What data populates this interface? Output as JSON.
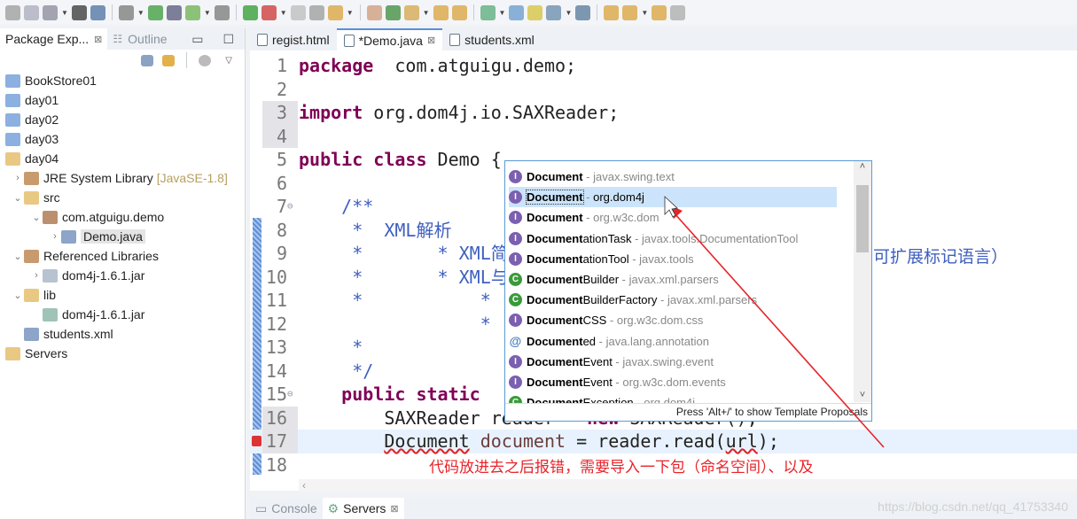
{
  "toolbar": {
    "icons": [
      "new",
      "save",
      "save-all",
      "user",
      "console",
      "debug-skip",
      "spring",
      "layout",
      "spring-boot",
      "debug",
      "run",
      "run-config",
      "stop",
      "external-tools",
      "new-package",
      "new-class",
      "refresh",
      "open-folder",
      "folder",
      "search",
      "open-type",
      "task",
      "marker",
      "pin",
      "globe",
      "next-annotation",
      "prev-annotation",
      "back",
      "forward"
    ]
  },
  "left": {
    "tabs": [
      {
        "label": "Package Exp...",
        "close": "⊠"
      },
      {
        "label": "Outline"
      }
    ],
    "tree": [
      {
        "label": "BookStore01",
        "depth": 0,
        "twisty": "",
        "icon": "web-project"
      },
      {
        "label": "day01",
        "depth": 0,
        "twisty": "",
        "icon": "web-project-warning"
      },
      {
        "label": "day02",
        "depth": 0,
        "twisty": "",
        "icon": "web-project"
      },
      {
        "label": "day03",
        "depth": 0,
        "twisty": "",
        "icon": "web-project"
      },
      {
        "label": "day04",
        "depth": 0,
        "twisty": "",
        "icon": "java-project"
      },
      {
        "label": "JRE System Library",
        "suffix": "[JavaSE-1.8]",
        "depth": 1,
        "twisty": "›",
        "icon": "library"
      },
      {
        "label": "src",
        "depth": 1,
        "twisty": "⌄",
        "icon": "source-folder"
      },
      {
        "label": "com.atguigu.demo",
        "depth": 2,
        "twisty": "⌄",
        "icon": "package"
      },
      {
        "label": "Demo.java",
        "depth": 3,
        "twisty": "›",
        "icon": "java-file",
        "selected": true
      },
      {
        "label": "Referenced Libraries",
        "depth": 1,
        "twisty": "⌄",
        "icon": "library"
      },
      {
        "label": "dom4j-1.6.1.jar",
        "depth": 2,
        "twisty": "›",
        "icon": "jar"
      },
      {
        "label": "lib",
        "depth": 1,
        "twisty": "⌄",
        "icon": "folder"
      },
      {
        "label": "dom4j-1.6.1.jar",
        "depth": 2,
        "twisty": "",
        "icon": "jar-file"
      },
      {
        "label": "students.xml",
        "depth": 1,
        "twisty": "",
        "icon": "xml-file"
      },
      {
        "label": "Servers",
        "depth": 0,
        "twisty": "",
        "icon": "folder"
      }
    ]
  },
  "editor": {
    "tabs": [
      {
        "label": "regist.html"
      },
      {
        "label": "*Demo.java",
        "close": "⊠",
        "active": true
      },
      {
        "label": "students.xml"
      }
    ],
    "lines": [
      {
        "n": "1",
        "seg": [
          [
            "kw",
            "package"
          ],
          [
            "",
            "  com.atguigu.demo;"
          ]
        ]
      },
      {
        "n": "2",
        "seg": []
      },
      {
        "n": "3",
        "seg": [
          [
            "kw",
            "import"
          ],
          [
            "",
            " org.dom4j.io.SAXReader;"
          ]
        ]
      },
      {
        "n": "4",
        "seg": []
      },
      {
        "n": "5",
        "seg": [
          [
            "kw",
            "public"
          ],
          [
            "",
            " "
          ],
          [
            "kw",
            "class"
          ],
          [
            "",
            " Demo {"
          ]
        ]
      },
      {
        "n": "6",
        "seg": []
      },
      {
        "n": "7",
        "seg": [
          [
            "cm",
            "    /**"
          ]
        ]
      },
      {
        "n": "8",
        "seg": [
          [
            "cm",
            "     *  XML解析"
          ]
        ]
      },
      {
        "n": "9",
        "seg": [
          [
            "cm",
            "     *       * XML简"
          ]
        ]
      },
      {
        "n": "10",
        "seg": [
          [
            "cm",
            "     *       * XML与"
          ]
        ]
      },
      {
        "n": "11",
        "seg": [
          [
            "cm",
            "     *           *"
          ]
        ]
      },
      {
        "n": "12",
        "seg": [
          [
            "cm",
            "                 *"
          ]
        ]
      },
      {
        "n": "13",
        "seg": [
          [
            "cm",
            "     *"
          ]
        ]
      },
      {
        "n": "14",
        "seg": [
          [
            "cm",
            "     */"
          ]
        ]
      },
      {
        "n": "15",
        "seg": [
          [
            "",
            "    "
          ],
          [
            "kw",
            "public"
          ],
          [
            "",
            " "
          ],
          [
            "kw",
            "static"
          ]
        ]
      },
      {
        "n": "16",
        "seg": [
          [
            "",
            "        SAXReader reader = "
          ],
          [
            "kw",
            "new"
          ],
          [
            "",
            " SAXReader();"
          ]
        ]
      },
      {
        "n": "17",
        "seg": [
          [
            "",
            "        "
          ],
          [
            "err",
            "Document"
          ],
          [
            "",
            " "
          ],
          [
            "var",
            "document"
          ],
          [
            "",
            " = reader.read("
          ],
          [
            "err",
            "url"
          ],
          [
            "",
            ");"
          ]
        ],
        "current": true
      },
      {
        "n": "18",
        "seg": []
      }
    ],
    "line9_tail": "可扩展标记语言）",
    "hscroll": "‹"
  },
  "popup": {
    "items": [
      {
        "bold": "Document",
        "rest": "",
        "pkg": "javax.swing.text",
        "icon": "interface"
      },
      {
        "bold": "Document",
        "rest": "",
        "pkg": "org.dom4j",
        "icon": "interface",
        "selected": true
      },
      {
        "bold": "Document",
        "rest": "",
        "pkg": "org.w3c.dom",
        "icon": "interface"
      },
      {
        "bold": "Document",
        "rest": "ationTask",
        "pkg": "javax.tools.DocumentationTool",
        "icon": "interface"
      },
      {
        "bold": "Document",
        "rest": "ationTool",
        "pkg": "javax.tools",
        "icon": "interface"
      },
      {
        "bold": "Document",
        "rest": "Builder",
        "pkg": "javax.xml.parsers",
        "icon": "abstract-class"
      },
      {
        "bold": "Document",
        "rest": "BuilderFactory",
        "pkg": "javax.xml.parsers",
        "icon": "abstract-class"
      },
      {
        "bold": "Document",
        "rest": "CSS",
        "pkg": "org.w3c.dom.css",
        "icon": "interface"
      },
      {
        "bold": "Document",
        "rest": "ed",
        "pkg": "java.lang.annotation",
        "icon": "annotation"
      },
      {
        "bold": "Document",
        "rest": "Event",
        "pkg": "javax.swing.event",
        "icon": "interface"
      },
      {
        "bold": "Document",
        "rest": "Event",
        "pkg": "org.w3c.dom.events",
        "icon": "interface"
      },
      {
        "bold": "Document",
        "rest": "Exception",
        "pkg": "org.dom4j",
        "icon": "class"
      }
    ],
    "footer": "Press 'Alt+/' to show Template Proposals",
    "scroll_up": "˄",
    "scroll_down": "˅"
  },
  "bottom": {
    "tabs": [
      {
        "label": "Console"
      },
      {
        "label": "Servers",
        "close": "⊠",
        "active": true
      }
    ]
  },
  "annotation": "代码放进去之后报错，需要导入一下包（命名空间）、以及",
  "watermark": "https://blog.csdn.net/qq_41753340",
  "colors": {
    "keyword": "#7f0055",
    "comment": "#3f5fbf",
    "annotation": "#e8242a",
    "selection": "#cce4fb",
    "arrow": "#e8242a"
  }
}
